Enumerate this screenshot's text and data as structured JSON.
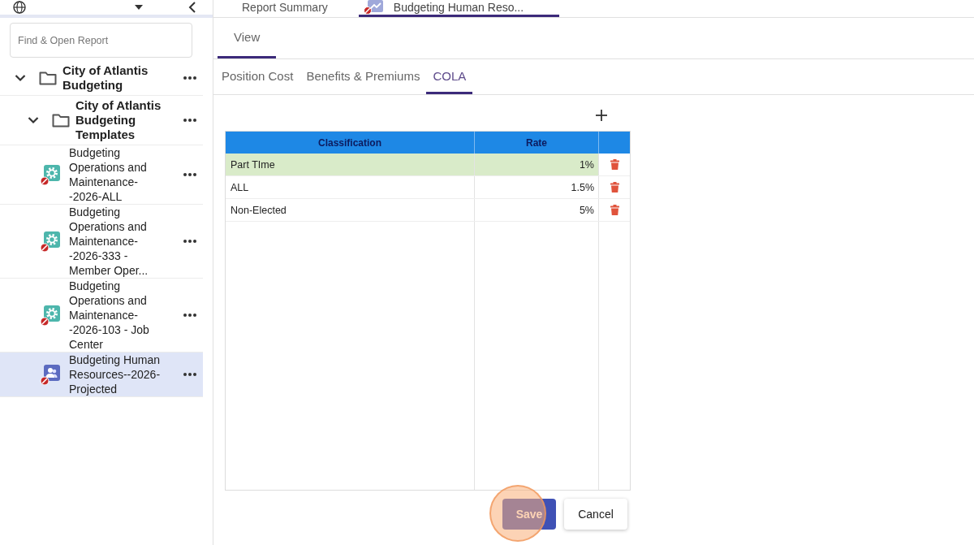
{
  "sidebar": {
    "search": {
      "placeholder": "Find & Open Report"
    },
    "tree": [
      {
        "label": "City of Atlantis Budgeting",
        "kind": "folder",
        "expanded": true,
        "selected": false,
        "children": [
          {
            "label": "City of Atlantis Budgeting Templates",
            "kind": "folder",
            "expanded": true,
            "selected": false,
            "children": [
              {
                "label": "Budgeting Operations and Maintenance- -2026-ALL",
                "kind": "operations",
                "selected": false
              },
              {
                "label": "Budgeting Operations and Maintenance- -2026-333 - Member Oper...",
                "kind": "operations",
                "selected": false
              },
              {
                "label": "Budgeting Operations and Maintenance- -2026-103 - Job Center",
                "kind": "operations",
                "selected": false
              },
              {
                "label": "Budgeting Human Resources--2026-Projected",
                "kind": "human-resources",
                "selected": true
              }
            ]
          }
        ]
      }
    ]
  },
  "report_tabs": [
    {
      "label": "Report Summary",
      "kind": "summary",
      "selected": false
    },
    {
      "label": "Budgeting Human Reso...",
      "kind": "report",
      "selected": true
    }
  ],
  "view_tabs": [
    {
      "label": "View",
      "selected": true
    }
  ],
  "section_tabs": [
    {
      "label": "Position Cost",
      "selected": false
    },
    {
      "label": "Benefits & Premiums",
      "selected": false
    },
    {
      "label": "COLA",
      "selected": true
    }
  ],
  "table": {
    "columns": [
      "Classification",
      "Rate"
    ],
    "rows": [
      {
        "classification": "Part TIme",
        "rate": "1%",
        "selected": true
      },
      {
        "classification": "ALL",
        "rate": "1.5%",
        "selected": false
      },
      {
        "classification": "Non-Elected",
        "rate": "5%",
        "selected": false
      }
    ]
  },
  "buttons": [
    {
      "label": "Save",
      "kind": "primary",
      "highlighted": true
    },
    {
      "label": "Cancel",
      "kind": "secondary",
      "highlighted": false
    }
  ]
}
